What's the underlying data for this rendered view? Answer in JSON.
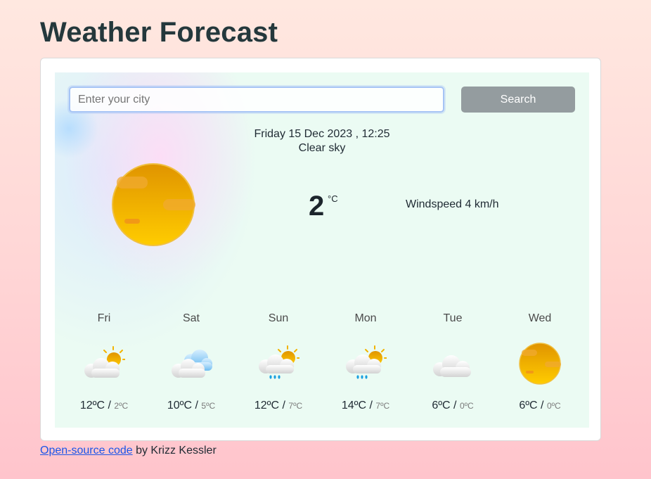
{
  "header": {
    "title": "Weather Forecast"
  },
  "search": {
    "placeholder": "Enter your city",
    "button_label": "Search"
  },
  "current": {
    "date": "Friday 15 Dec 2023 , 12:25",
    "description": "Clear sky",
    "temperature": "2",
    "unit": "°C",
    "windspeed": "Windspeed 4 km/h",
    "icon": "sun-icon"
  },
  "forecast": [
    {
      "day": "Fri",
      "max": "12ºC",
      "sep": " / ",
      "min": "2ºC",
      "icon": "partly-cloudy-icon"
    },
    {
      "day": "Sat",
      "max": "10ºC",
      "sep": " / ",
      "min": "5ºC",
      "icon": "cloudy-icon"
    },
    {
      "day": "Sun",
      "max": "12ºC",
      "sep": " / ",
      "min": "7ºC",
      "icon": "sun-rain-icon"
    },
    {
      "day": "Mon",
      "max": "14ºC",
      "sep": " / ",
      "min": "7ºC",
      "icon": "sun-rain-icon"
    },
    {
      "day": "Tue",
      "max": "6ºC",
      "sep": " / ",
      "min": "0ºC",
      "icon": "cloud-icon"
    },
    {
      "day": "Wed",
      "max": "6ºC",
      "sep": " / ",
      "min": "0ºC",
      "icon": "sun-icon"
    }
  ],
  "footer": {
    "link_text": "Open-source code",
    "suffix": " by Krizz Kessler"
  },
  "colors": {
    "sun": "#f5b400",
    "search_button": "#949c9f",
    "panel": "#ebfbf3",
    "link": "#1a55e8"
  }
}
